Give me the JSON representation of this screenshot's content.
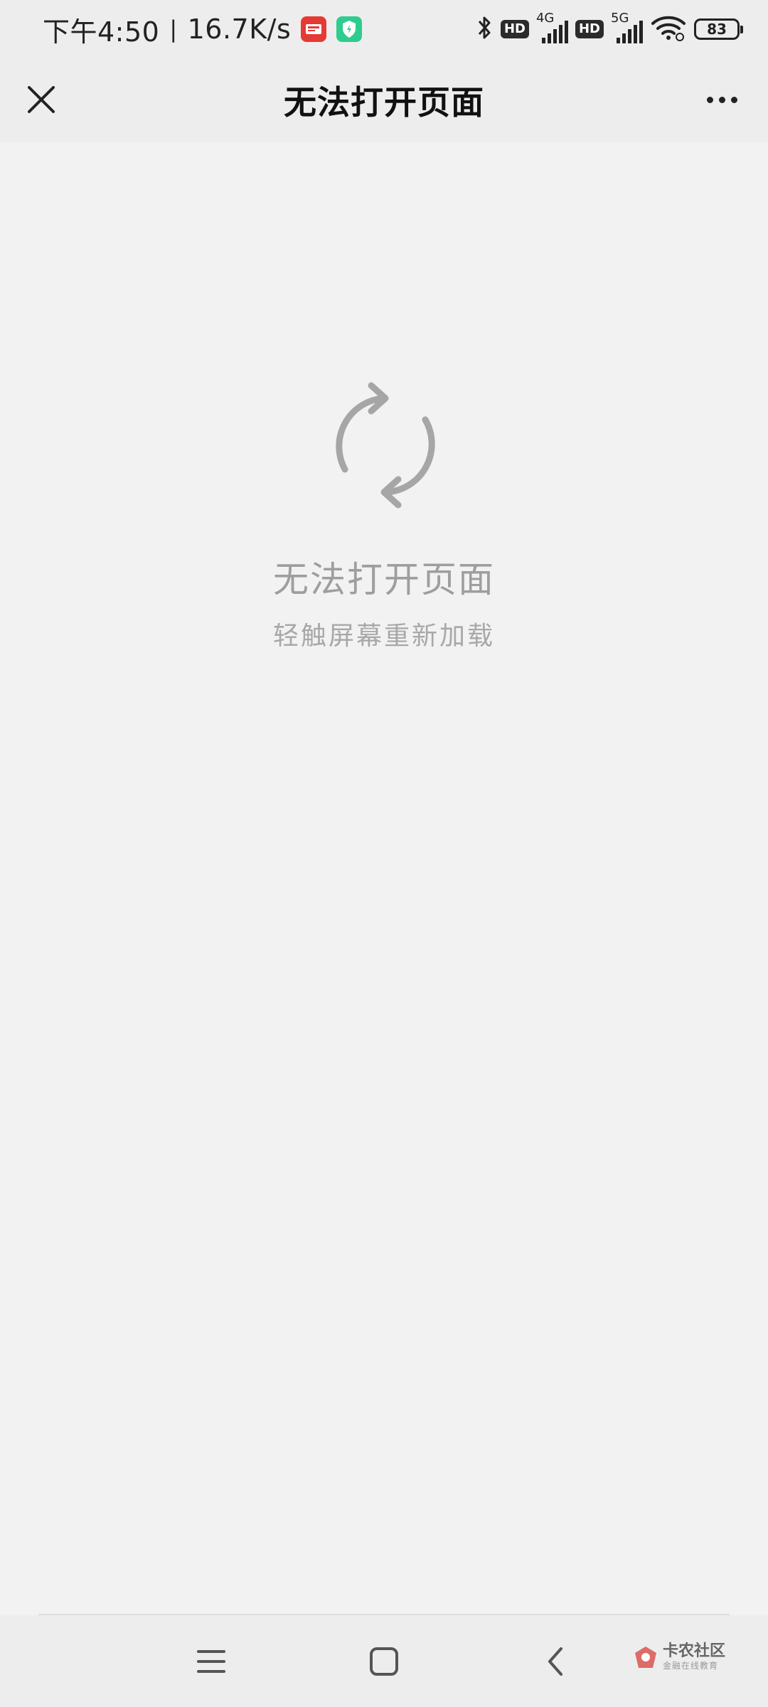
{
  "status_bar": {
    "time": "下午4:50",
    "separator": "|",
    "net_speed": "16.7K/s",
    "hd1": "HD",
    "net1": "4G",
    "hd2": "HD",
    "net2": "5G",
    "battery": "83"
  },
  "header": {
    "title": "无法打开页面"
  },
  "error": {
    "title": "无法打开页面",
    "subtitle": "轻触屏幕重新加载"
  },
  "watermark": {
    "main": "卡农社区",
    "sub": "金融在线教育"
  },
  "colors": {
    "background": "#f2f2f2",
    "bar_background": "#ededed",
    "reload_icon": "#a6a6a6",
    "error_title": "#9e9e9e"
  },
  "icons": {
    "close": "close-icon",
    "more": "more-dots-icon",
    "reload": "refresh-icon",
    "menu": "menu-icon",
    "home": "home-icon",
    "back": "back-icon"
  }
}
